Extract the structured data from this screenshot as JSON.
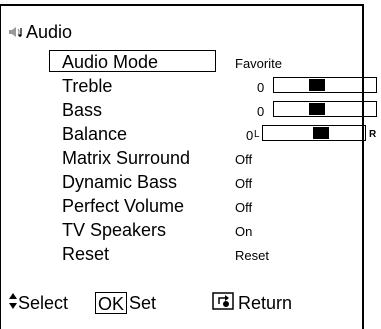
{
  "menu": {
    "title": "Audio",
    "title_icon": "speaker-music-icon",
    "items": [
      {
        "label": "Audio Mode",
        "value": "Favorite",
        "selected": true
      },
      {
        "label": "Treble",
        "value": "0",
        "level": 0
      },
      {
        "label": "Bass",
        "value": "0",
        "level": 0
      },
      {
        "label": "Balance",
        "value": "0",
        "level": 0,
        "left_mark": "L",
        "right_mark": "R"
      },
      {
        "label": "Matrix Surround",
        "value": "Off"
      },
      {
        "label": "Dynamic Bass",
        "value": "Off"
      },
      {
        "label": "Perfect Volume",
        "value": "Off"
      },
      {
        "label": "TV Speakers",
        "value": "On"
      },
      {
        "label": "Reset",
        "value": "Reset"
      }
    ]
  },
  "footer": {
    "select_label": "Select",
    "select_icon": "up-down-arrow-icon",
    "ok_key": "OK",
    "set_label": "Set",
    "return_icon": "return-key-icon",
    "return_label": "Return"
  },
  "colors": {
    "background": "#ffffff",
    "foreground": "#000000"
  }
}
